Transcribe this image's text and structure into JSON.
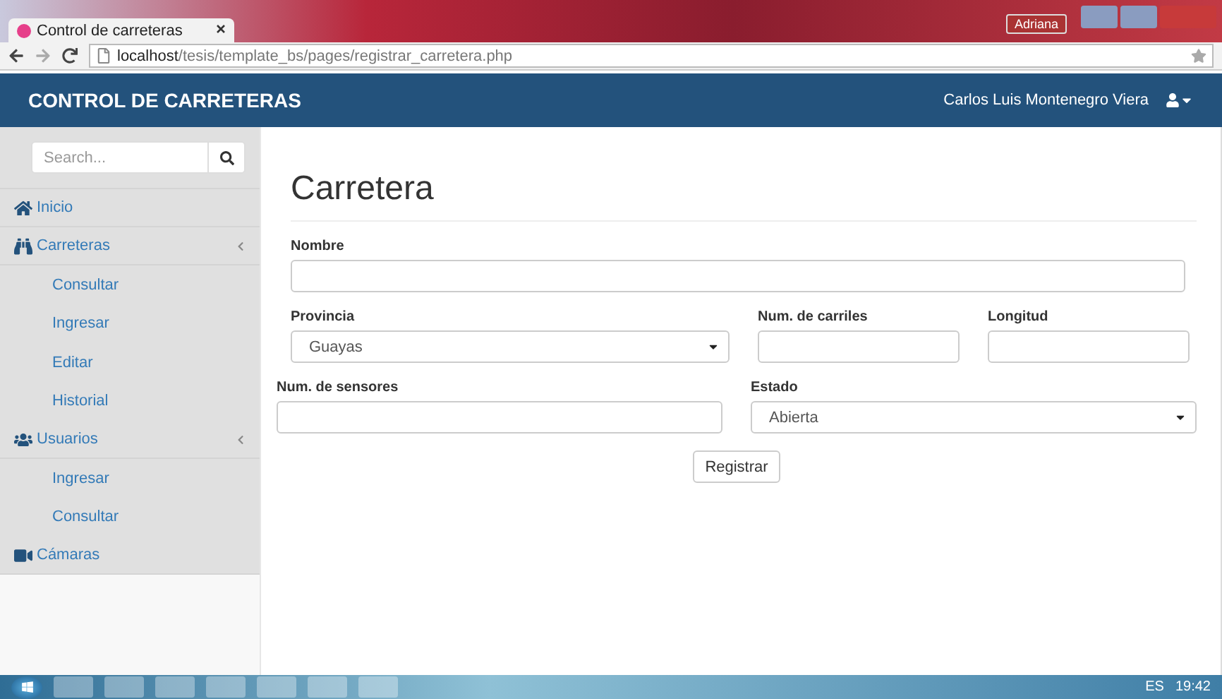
{
  "browser": {
    "tab_title": "Control de carreteras",
    "profile": "Adriana",
    "url_host": "localhost",
    "url_path": "/tesis/template_bs/pages/registrar_carretera.php"
  },
  "navbar": {
    "brand": "CONTROL DE CARRETERAS",
    "user": "Carlos Luis Montenegro Viera"
  },
  "sidebar": {
    "search": {
      "placeholder": "Search..."
    },
    "items": [
      {
        "label": "Inicio"
      },
      {
        "label": "Carreteras",
        "expanded": true,
        "children": [
          {
            "label": "Consultar"
          },
          {
            "label": "Ingresar"
          },
          {
            "label": "Editar"
          },
          {
            "label": "Historial"
          }
        ]
      },
      {
        "label": "Usuarios",
        "expanded": true,
        "children": [
          {
            "label": "Ingresar"
          },
          {
            "label": "Consultar"
          }
        ]
      },
      {
        "label": "Cámaras"
      }
    ]
  },
  "form": {
    "title": "Carretera",
    "rows": [
      [
        {
          "label": "Nombre",
          "kind": "text"
        }
      ],
      [
        {
          "label": "Provincia",
          "kind": "select",
          "value": "Guayas"
        },
        {
          "label": "Num. de carriles",
          "kind": "text"
        },
        {
          "label": "Longitud",
          "kind": "text"
        }
      ],
      [
        {
          "label": "Num. de sensores",
          "kind": "text"
        },
        {
          "label": "Estado",
          "kind": "select",
          "value": "Abierta"
        }
      ]
    ],
    "submit": "Registrar"
  },
  "taskbar": {
    "language": "ES",
    "time": "19:42"
  }
}
